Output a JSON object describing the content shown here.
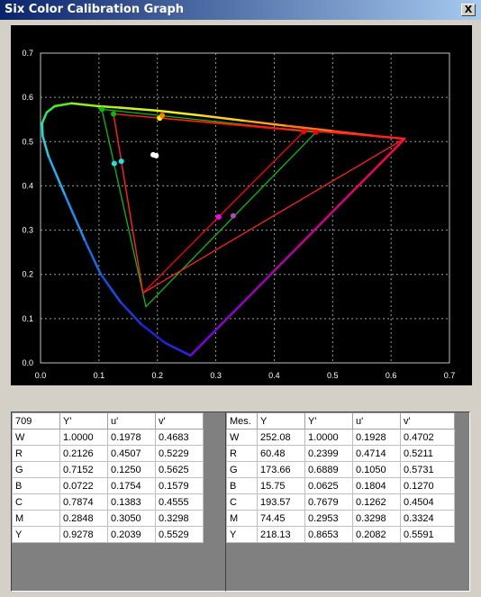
{
  "window": {
    "title": "Six Color Calibration Graph",
    "close_glyph": "X"
  },
  "chart_data": {
    "type": "scatter",
    "xlim": [
      0,
      0.7
    ],
    "ylim": [
      0,
      0.7
    ],
    "x_ticks": [
      "0.0",
      "0.1",
      "0.2",
      "0.3",
      "0.4",
      "0.5",
      "0.6",
      "0.7"
    ],
    "y_ticks": [
      "0.0",
      "0.1",
      "0.2",
      "0.3",
      "0.4",
      "0.5",
      "0.6",
      "0.7"
    ],
    "grid": true,
    "gamut_triangles": [
      {
        "color": "#ff0000",
        "points": [
          [
            0.4507,
            0.5229
          ],
          [
            0.125,
            0.5625
          ],
          [
            0.1754,
            0.1579
          ]
        ]
      },
      {
        "color": "#00c000",
        "points": [
          [
            0.4714,
            0.5211
          ],
          [
            0.105,
            0.5731
          ],
          [
            0.1804,
            0.127
          ]
        ]
      },
      {
        "color": "#ff2020",
        "points": [
          [
            0.6219,
            0.5061
          ],
          [
            0.125,
            0.5625
          ],
          [
            0.1754,
            0.1579
          ]
        ]
      }
    ],
    "points": [
      {
        "label": "W target",
        "x": 0.1978,
        "y": 0.4683,
        "color": "#ffffff"
      },
      {
        "label": "W measured",
        "x": 0.1928,
        "y": 0.4702,
        "color": "#ffffff"
      },
      {
        "label": "C target",
        "x": 0.1383,
        "y": 0.4555,
        "color": "#20e0e0"
      },
      {
        "label": "C measured",
        "x": 0.1262,
        "y": 0.4504,
        "color": "#20e0e0"
      },
      {
        "label": "M target",
        "x": 0.305,
        "y": 0.3298,
        "color": "#ff00ff"
      },
      {
        "label": "M measured",
        "x": 0.3298,
        "y": 0.3324,
        "color": "#c040c0"
      },
      {
        "label": "Y target",
        "x": 0.2039,
        "y": 0.5529,
        "color": "#ffff00"
      },
      {
        "label": "Y measured",
        "x": 0.2082,
        "y": 0.5591,
        "color": "#ff8000"
      },
      {
        "label": "R target",
        "x": 0.4507,
        "y": 0.5229,
        "color": "#ff0000"
      },
      {
        "label": "R measured",
        "x": 0.4714,
        "y": 0.5211,
        "color": "#ff0000"
      },
      {
        "label": "G target",
        "x": 0.125,
        "y": 0.5625,
        "color": "#00c000"
      },
      {
        "label": "G measured",
        "x": 0.105,
        "y": 0.5731,
        "color": "#00c000"
      }
    ]
  },
  "target_table": {
    "headers": [
      "709",
      "Y'",
      "u'",
      "v'"
    ],
    "rows": [
      [
        "W",
        "1.0000",
        "0.1978",
        "0.4683"
      ],
      [
        "R",
        "0.2126",
        "0.4507",
        "0.5229"
      ],
      [
        "G",
        "0.7152",
        "0.1250",
        "0.5625"
      ],
      [
        "B",
        "0.0722",
        "0.1754",
        "0.1579"
      ],
      [
        "C",
        "0.7874",
        "0.1383",
        "0.4555"
      ],
      [
        "M",
        "0.2848",
        "0.3050",
        "0.3298"
      ],
      [
        "Y",
        "0.9278",
        "0.2039",
        "0.5529"
      ]
    ]
  },
  "measured_table": {
    "headers": [
      "Mes.",
      "Y",
      "Y'",
      "u'",
      "v'"
    ],
    "rows": [
      [
        "W",
        "252.08",
        "1.0000",
        "0.1928",
        "0.4702"
      ],
      [
        "R",
        "60.48",
        "0.2399",
        "0.4714",
        "0.5211"
      ],
      [
        "G",
        "173.66",
        "0.6889",
        "0.1050",
        "0.5731"
      ],
      [
        "B",
        "15.75",
        "0.0625",
        "0.1804",
        "0.1270"
      ],
      [
        "C",
        "193.57",
        "0.7679",
        "0.1262",
        "0.4504"
      ],
      [
        "M",
        "74.45",
        "0.2953",
        "0.3298",
        "0.3324"
      ],
      [
        "Y",
        "218.13",
        "0.8653",
        "0.2082",
        "0.5591"
      ]
    ]
  }
}
